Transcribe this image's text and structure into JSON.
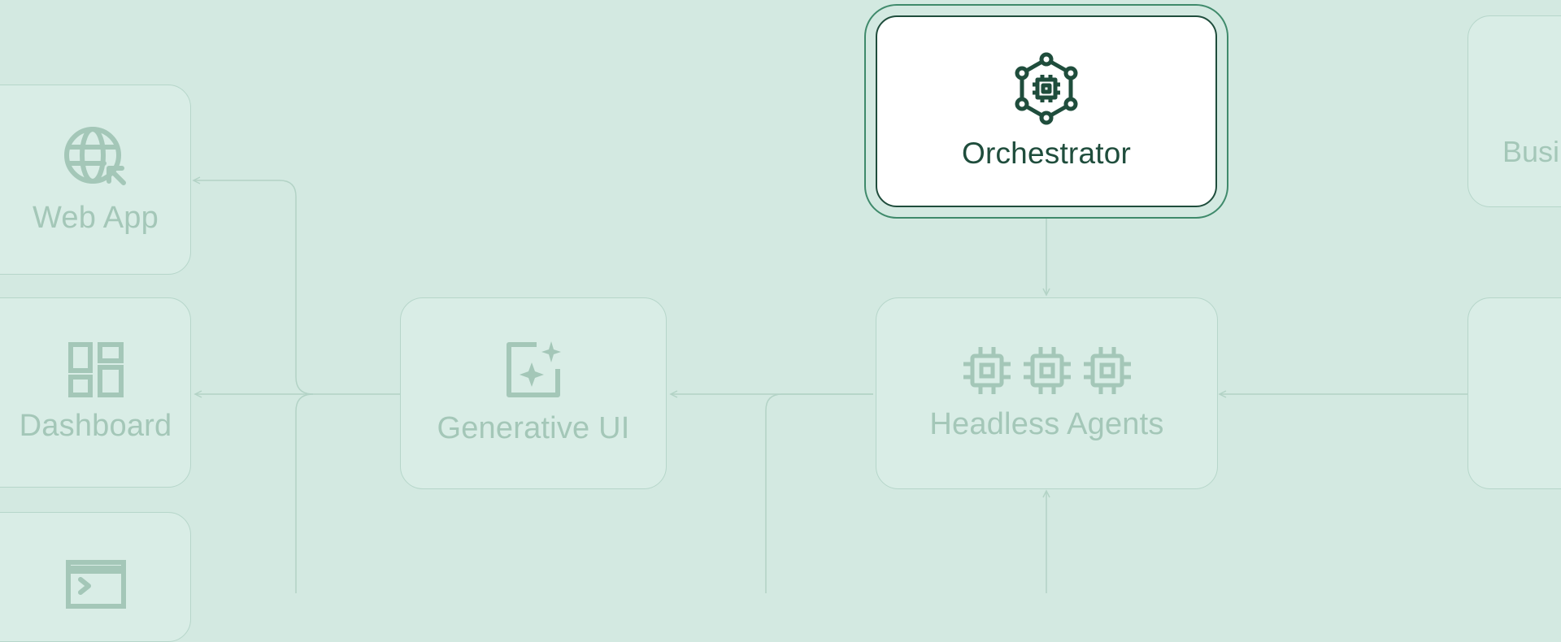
{
  "nodes": {
    "web_app": {
      "label": "Web App",
      "icon": "globe-cursor-icon"
    },
    "dashboard": {
      "label": "Dashboard",
      "icon": "grid-layout-icon"
    },
    "terminal": {
      "label": "",
      "icon": "terminal-icon"
    },
    "generative_ui": {
      "label": "Generative UI",
      "icon": "sparkle-canvas-icon"
    },
    "orchestrator": {
      "label": "Orchestrator",
      "icon": "network-chip-icon"
    },
    "headless_agents": {
      "label": "Headless Agents",
      "icon": "chip-icon"
    },
    "business": {
      "label": "Busi"
    },
    "right_lower": {
      "label": ""
    }
  },
  "colors": {
    "background": "#d3e9e1",
    "node_fill": "#d9ede6",
    "node_border": "#b6d6ca",
    "muted_text": "#a4c7b8",
    "active_text": "#1f4d3c",
    "active_ring": "#3f8a6b"
  }
}
